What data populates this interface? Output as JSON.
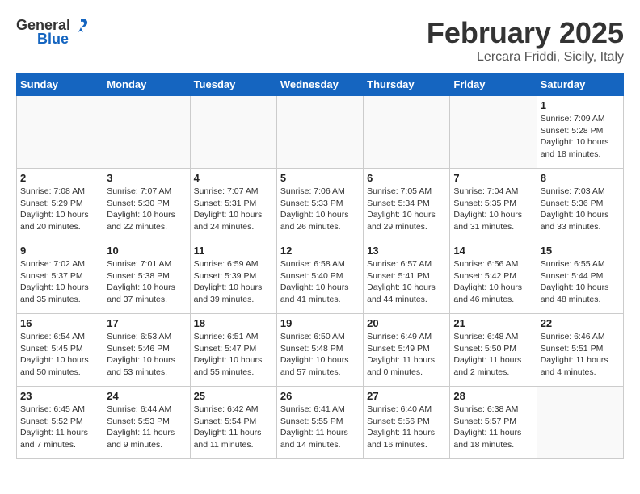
{
  "header": {
    "logo_general": "General",
    "logo_blue": "Blue",
    "month": "February 2025",
    "location": "Lercara Friddi, Sicily, Italy"
  },
  "weekdays": [
    "Sunday",
    "Monday",
    "Tuesday",
    "Wednesday",
    "Thursday",
    "Friday",
    "Saturday"
  ],
  "weeks": [
    [
      {
        "day": "",
        "info": ""
      },
      {
        "day": "",
        "info": ""
      },
      {
        "day": "",
        "info": ""
      },
      {
        "day": "",
        "info": ""
      },
      {
        "day": "",
        "info": ""
      },
      {
        "day": "",
        "info": ""
      },
      {
        "day": "1",
        "info": "Sunrise: 7:09 AM\nSunset: 5:28 PM\nDaylight: 10 hours and 18 minutes."
      }
    ],
    [
      {
        "day": "2",
        "info": "Sunrise: 7:08 AM\nSunset: 5:29 PM\nDaylight: 10 hours and 20 minutes."
      },
      {
        "day": "3",
        "info": "Sunrise: 7:07 AM\nSunset: 5:30 PM\nDaylight: 10 hours and 22 minutes."
      },
      {
        "day": "4",
        "info": "Sunrise: 7:07 AM\nSunset: 5:31 PM\nDaylight: 10 hours and 24 minutes."
      },
      {
        "day": "5",
        "info": "Sunrise: 7:06 AM\nSunset: 5:33 PM\nDaylight: 10 hours and 26 minutes."
      },
      {
        "day": "6",
        "info": "Sunrise: 7:05 AM\nSunset: 5:34 PM\nDaylight: 10 hours and 29 minutes."
      },
      {
        "day": "7",
        "info": "Sunrise: 7:04 AM\nSunset: 5:35 PM\nDaylight: 10 hours and 31 minutes."
      },
      {
        "day": "8",
        "info": "Sunrise: 7:03 AM\nSunset: 5:36 PM\nDaylight: 10 hours and 33 minutes."
      }
    ],
    [
      {
        "day": "9",
        "info": "Sunrise: 7:02 AM\nSunset: 5:37 PM\nDaylight: 10 hours and 35 minutes."
      },
      {
        "day": "10",
        "info": "Sunrise: 7:01 AM\nSunset: 5:38 PM\nDaylight: 10 hours and 37 minutes."
      },
      {
        "day": "11",
        "info": "Sunrise: 6:59 AM\nSunset: 5:39 PM\nDaylight: 10 hours and 39 minutes."
      },
      {
        "day": "12",
        "info": "Sunrise: 6:58 AM\nSunset: 5:40 PM\nDaylight: 10 hours and 41 minutes."
      },
      {
        "day": "13",
        "info": "Sunrise: 6:57 AM\nSunset: 5:41 PM\nDaylight: 10 hours and 44 minutes."
      },
      {
        "day": "14",
        "info": "Sunrise: 6:56 AM\nSunset: 5:42 PM\nDaylight: 10 hours and 46 minutes."
      },
      {
        "day": "15",
        "info": "Sunrise: 6:55 AM\nSunset: 5:44 PM\nDaylight: 10 hours and 48 minutes."
      }
    ],
    [
      {
        "day": "16",
        "info": "Sunrise: 6:54 AM\nSunset: 5:45 PM\nDaylight: 10 hours and 50 minutes."
      },
      {
        "day": "17",
        "info": "Sunrise: 6:53 AM\nSunset: 5:46 PM\nDaylight: 10 hours and 53 minutes."
      },
      {
        "day": "18",
        "info": "Sunrise: 6:51 AM\nSunset: 5:47 PM\nDaylight: 10 hours and 55 minutes."
      },
      {
        "day": "19",
        "info": "Sunrise: 6:50 AM\nSunset: 5:48 PM\nDaylight: 10 hours and 57 minutes."
      },
      {
        "day": "20",
        "info": "Sunrise: 6:49 AM\nSunset: 5:49 PM\nDaylight: 11 hours and 0 minutes."
      },
      {
        "day": "21",
        "info": "Sunrise: 6:48 AM\nSunset: 5:50 PM\nDaylight: 11 hours and 2 minutes."
      },
      {
        "day": "22",
        "info": "Sunrise: 6:46 AM\nSunset: 5:51 PM\nDaylight: 11 hours and 4 minutes."
      }
    ],
    [
      {
        "day": "23",
        "info": "Sunrise: 6:45 AM\nSunset: 5:52 PM\nDaylight: 11 hours and 7 minutes."
      },
      {
        "day": "24",
        "info": "Sunrise: 6:44 AM\nSunset: 5:53 PM\nDaylight: 11 hours and 9 minutes."
      },
      {
        "day": "25",
        "info": "Sunrise: 6:42 AM\nSunset: 5:54 PM\nDaylight: 11 hours and 11 minutes."
      },
      {
        "day": "26",
        "info": "Sunrise: 6:41 AM\nSunset: 5:55 PM\nDaylight: 11 hours and 14 minutes."
      },
      {
        "day": "27",
        "info": "Sunrise: 6:40 AM\nSunset: 5:56 PM\nDaylight: 11 hours and 16 minutes."
      },
      {
        "day": "28",
        "info": "Sunrise: 6:38 AM\nSunset: 5:57 PM\nDaylight: 11 hours and 18 minutes."
      },
      {
        "day": "",
        "info": ""
      }
    ]
  ]
}
